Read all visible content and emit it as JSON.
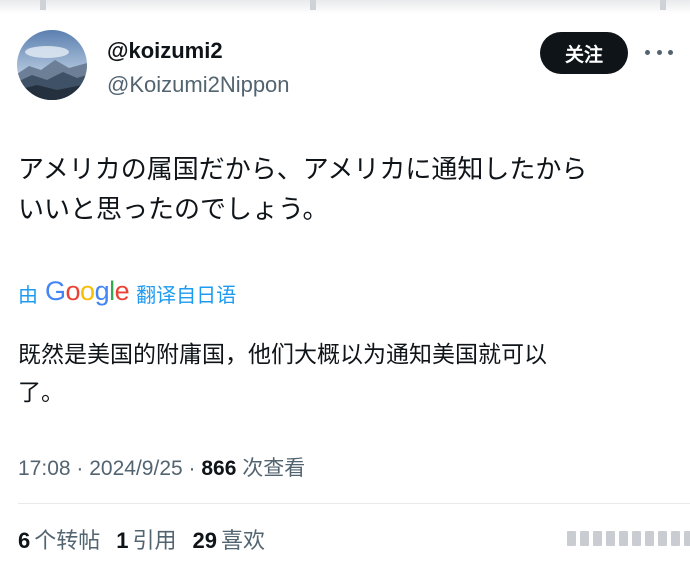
{
  "user": {
    "display_name": "@koizumi2",
    "handle": "@Koizumi2Nippon",
    "avatar": "mountain-landscape-avatar"
  },
  "follow_button": {
    "label": "关注"
  },
  "more_menu": {
    "icon": "more-horizontal-icon"
  },
  "tweet": {
    "text": "アメリカの属国だから、アメリカに通知したから\nいいと思ったのでしょう。"
  },
  "translation": {
    "prefix": "由",
    "provider": "Google",
    "suffix": "翻译自日语",
    "text": "既然是美国的附庸国，他们大概以为通知美国就可以\n了。"
  },
  "meta": {
    "time": "17:08",
    "separator": "·",
    "date": "2024/9/25",
    "views_count": "866",
    "views_label": "次查看"
  },
  "stats": {
    "reposts_count": "6",
    "reposts_label": "个转帖",
    "quotes_count": "1",
    "quotes_label": "引用",
    "likes_count": "29",
    "likes_label": "喜欢"
  },
  "colors": {
    "text": "#0f1419",
    "secondary": "#536471",
    "link": "#1d9bf0",
    "button_bg": "#0f1419",
    "divider": "#e7e9ea"
  }
}
